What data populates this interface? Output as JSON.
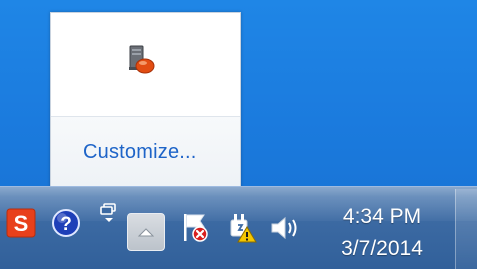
{
  "flyout": {
    "icons": [
      {
        "name": "network-drive-icon"
      }
    ],
    "customize_label": "Customize..."
  },
  "taskbar": {
    "tray_icons": [
      {
        "name": "s-app-icon",
        "text": "S"
      },
      {
        "name": "help-icon",
        "text": "?"
      },
      {
        "name": "pin-icon"
      },
      {
        "name": "show-hidden-icons-arrow"
      },
      {
        "name": "action-center-flag-icon"
      },
      {
        "name": "power-warning-icon"
      },
      {
        "name": "volume-icon"
      }
    ],
    "clock": {
      "time": "4:34 PM",
      "date": "3/7/2014"
    }
  },
  "colors": {
    "desktop": "#1b7bde",
    "taskbar": "#3c6aa3",
    "link": "#1e64c8",
    "s_icon": "#e8401c",
    "help_icon": "#1e3fb8"
  }
}
